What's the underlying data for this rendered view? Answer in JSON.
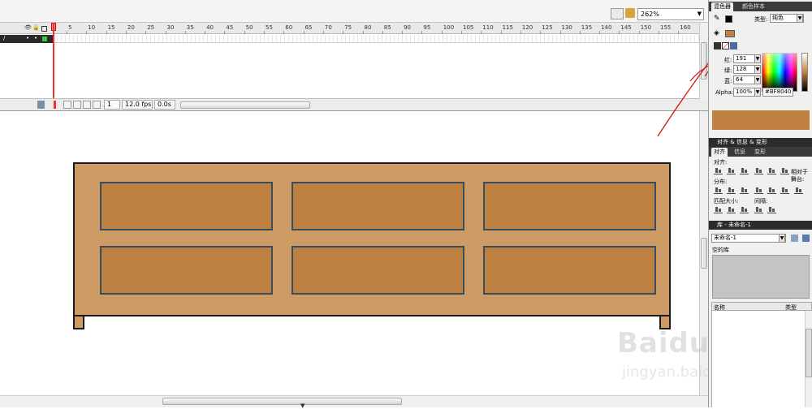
{
  "toolbar": {
    "zoom": "262%"
  },
  "timeline": {
    "ruler_labels": [
      "5",
      "10",
      "15",
      "20",
      "25",
      "30",
      "35",
      "40",
      "45",
      "50",
      "55",
      "60",
      "65",
      "70",
      "75",
      "80",
      "85",
      "90",
      "95",
      "100",
      "105",
      "110",
      "115",
      "120",
      "125",
      "130",
      "135",
      "140",
      "145",
      "150",
      "155",
      "160"
    ],
    "current_frame": "1",
    "frame_rate": "12.0 fps",
    "elapsed_time": "0.0s"
  },
  "mixer": {
    "tabs": [
      "混色器",
      "颜色样本"
    ],
    "type_label": "类型:",
    "type_value": "纯色",
    "red_label": "红:",
    "red_value": "191",
    "green_label": "绿:",
    "green_value": "128",
    "blue_label": "蓝:",
    "blue_value": "64",
    "alpha_label": "Alpha:",
    "alpha_value": "100%",
    "hex_value": "#BF8040",
    "swatch_color": "#bf8040"
  },
  "align_panel": {
    "header": "对齐 & 信息 & 变形",
    "tabs": [
      "对齐",
      "信息",
      "变形"
    ],
    "align_label": "对齐:",
    "distribute_label": "分布:",
    "match_size_label": "匹配大小:",
    "spacing_label": "间隔:",
    "relative_stage_label": "相对于\n舞台:"
  },
  "library": {
    "header": "库 - 未命名-1",
    "document_select": "未命名-1",
    "empty_text": "空的库",
    "col_name": "名称",
    "col_type": "类型"
  },
  "stage": {
    "cabinet_fill": "#cf9b64",
    "panel_fill": "#be8040",
    "panel_border": "#345060",
    "outline": "#1a1a1a"
  },
  "watermark": {
    "main": "Baidu经验",
    "sub": "jingyan.baidu.com"
  }
}
